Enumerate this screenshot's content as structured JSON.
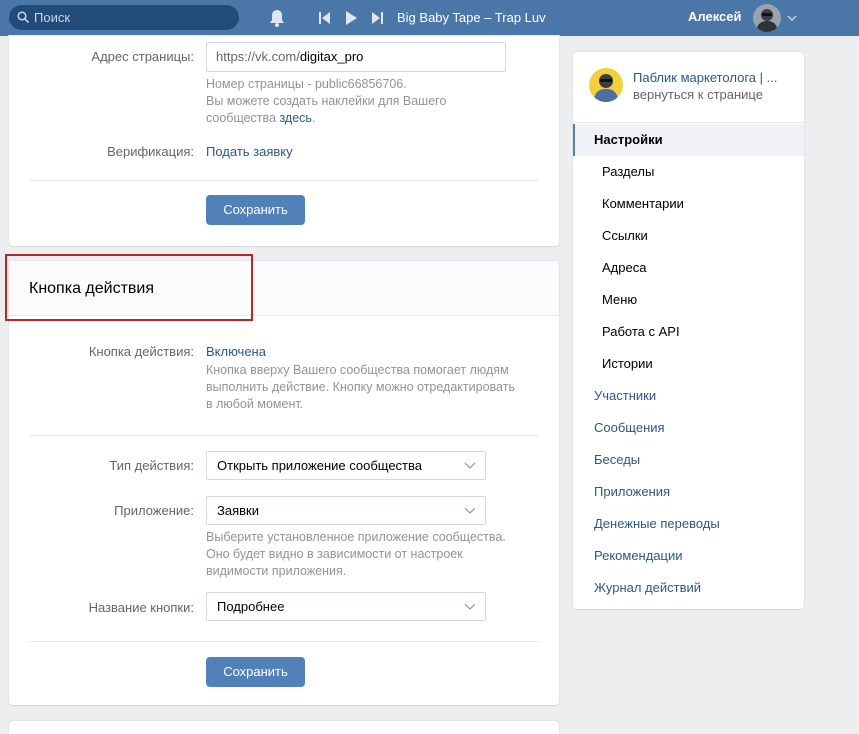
{
  "topbar": {
    "search_placeholder": "Поиск",
    "track": "Big Baby Tape – Trap Luv",
    "user_name": "Алексей"
  },
  "address_section": {
    "label": "Адрес страницы:",
    "url_prefix": "https://vk.com/",
    "url_value": "digitax_pro",
    "hint_line1": "Номер страницы - public66856706.",
    "hint_line2": "Вы можете создать наклейки для Вашего",
    "hint_line3_text": "сообщества",
    "hint_line3_link": "здесь",
    "hint_line3_end": ".",
    "verification_label": "Верификация:",
    "verification_link": "Подать заявку",
    "save_label": "Сохранить"
  },
  "action_button_section": {
    "title": "Кнопка действия",
    "status_label": "Кнопка действия:",
    "status_value": "Включена",
    "status_hint_1": "Кнопка вверху Вашего сообщества помогает людям",
    "status_hint_2": "выполнить действие. Кнопку можно отредактировать",
    "status_hint_3": "в любой момент.",
    "action_type_label": "Тип действия:",
    "action_type_value": "Открыть приложение сообщества",
    "app_label": "Приложение:",
    "app_value": "Заявки",
    "app_hint_1": "Выберите установленное приложение сообщества.",
    "app_hint_2": "Оно будет видно в зависимости от настроек",
    "app_hint_3": "видимости приложения.",
    "button_name_label": "Название кнопки:",
    "button_name_value": "Подробнее",
    "save_label": "Сохранить"
  },
  "menu": {
    "group_name": "Паблик маркетолога | ...",
    "back_label": "вернуться к странице",
    "items": [
      {
        "label": "Настройки"
      },
      {
        "label": "Разделы"
      },
      {
        "label": "Комментарии"
      },
      {
        "label": "Ссылки"
      },
      {
        "label": "Адреса"
      },
      {
        "label": "Меню"
      },
      {
        "label": "Работа с API"
      },
      {
        "label": "Истории"
      },
      {
        "label": "Участники"
      },
      {
        "label": "Сообщения"
      },
      {
        "label": "Беседы"
      },
      {
        "label": "Приложения"
      },
      {
        "label": "Денежные переводы"
      },
      {
        "label": "Рекомендации"
      },
      {
        "label": "Журнал действий"
      }
    ]
  },
  "colors": {
    "header": "#4a76a8",
    "accent": "#5181b8",
    "link": "#2a5885",
    "highlight": "#b2282b"
  }
}
